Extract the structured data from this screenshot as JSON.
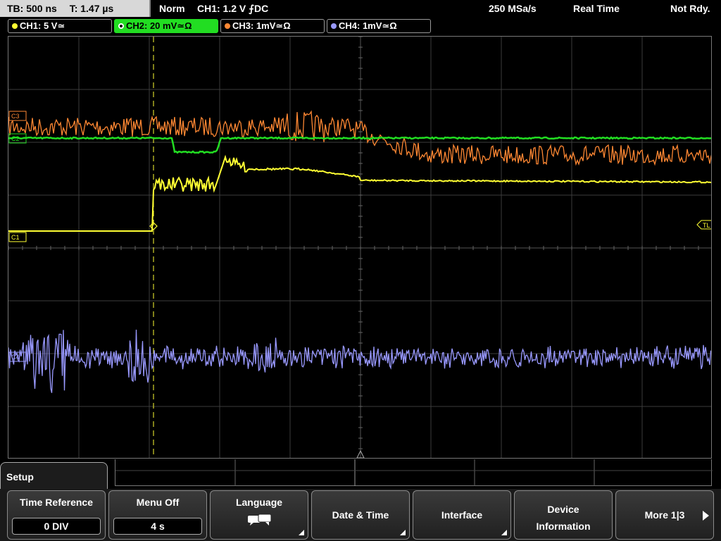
{
  "status": {
    "timebase": "TB: 500 ns",
    "trigger_time": "T: 1.47 µs",
    "mode": "Norm",
    "trigger_setting": "CH1: 1.2 V ⨍DC",
    "sample_rate": "250 MSa/s",
    "acquisition": "Real Time",
    "state": "Not Rdy."
  },
  "channels": [
    {
      "label": "CH1: 5 V≃",
      "color": "#ffff33"
    },
    {
      "label": "CH2: 20 mV≃Ω",
      "color": "#22dd22"
    },
    {
      "label": "CH3: 1mV≃Ω",
      "color": "#ff8833"
    },
    {
      "label": "CH4: 1mV≃Ω",
      "color": "#9999ff"
    }
  ],
  "markers": {
    "ch1": "C1",
    "ch2": "C2",
    "ch3": "C3",
    "ch4": "C4",
    "trigger_level": "TL",
    "trigger_pos": "T"
  },
  "menu": {
    "title": "Setup",
    "keys": [
      {
        "label": "Time Reference",
        "value": "0 DIV"
      },
      {
        "label": "Menu Off",
        "value": "4 s"
      },
      {
        "label": "Language"
      },
      {
        "label": "Date & Time"
      },
      {
        "label": "Interface"
      },
      {
        "label": "Device",
        "label2": "Information"
      },
      {
        "label": "More 1|3"
      }
    ]
  },
  "colors": {
    "ch1": "#ffff33",
    "ch2": "#22dd22",
    "ch3": "#ff8833",
    "ch4": "#9999ff",
    "grid": "#555555"
  }
}
